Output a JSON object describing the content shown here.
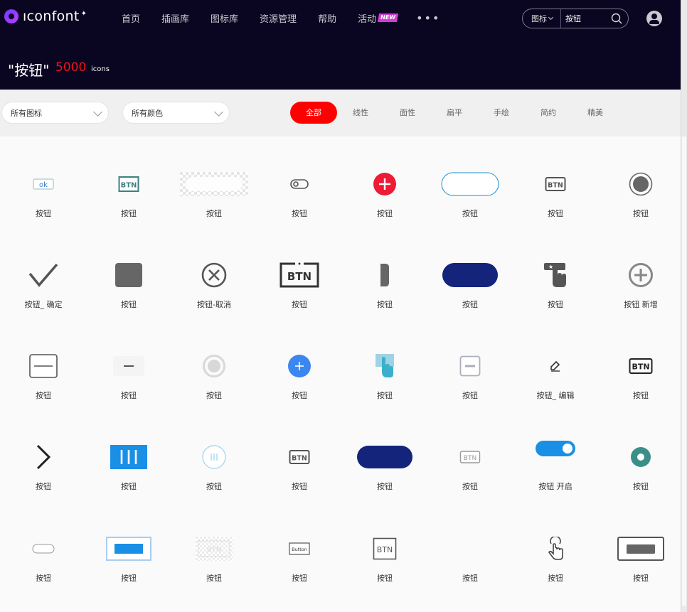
{
  "logo": {
    "text": "ıconfont",
    "star": "✦"
  },
  "nav": {
    "items": [
      "首页",
      "插画库",
      "图标库",
      "资源管理",
      "帮助",
      "活动"
    ],
    "new_badge": "NEW",
    "more": "•••"
  },
  "search": {
    "type": "图标",
    "value": "按钮"
  },
  "banner": {
    "title": "\"按钮\"",
    "count": "5000",
    "unit": "icons"
  },
  "filters": {
    "icon_select": "所有图标",
    "color_select": "所有颜色"
  },
  "style_tabs": [
    "全部",
    "线性",
    "面性",
    "扁平",
    "手绘",
    "简约",
    "精美"
  ],
  "icons": {
    "row1": [
      "按钮",
      "按钮",
      "按钮",
      "按钮",
      "按钮",
      "按钮",
      "按钮",
      "按钮"
    ],
    "row2": [
      "按钮_ 确定",
      "按钮",
      "按钮-取消",
      "按钮",
      "按钮",
      "按钮",
      "按钮",
      "按钮 新增"
    ],
    "row3": [
      "按钮",
      "按钮",
      "按钮",
      "按钮",
      "按钮",
      "按钮",
      "按钮_ 编辑",
      "按钮"
    ],
    "row4": [
      "按钮",
      "按钮",
      "按钮",
      "按钮",
      "按钮",
      "按钮",
      "按钮 开启",
      "按钮"
    ],
    "row5": [
      "按钮",
      "按钮",
      "按钮",
      "按钮",
      "按钮",
      "按钮",
      "按钮",
      "按钮"
    ]
  },
  "glyph_text": {
    "ok": "ok",
    "btn": "BTN",
    "button": "Button"
  },
  "colors": {
    "nav_bg": "#0a0621",
    "accent_red": "#ff0000",
    "navy": "#13247a",
    "blue": "#1a8fe6"
  }
}
